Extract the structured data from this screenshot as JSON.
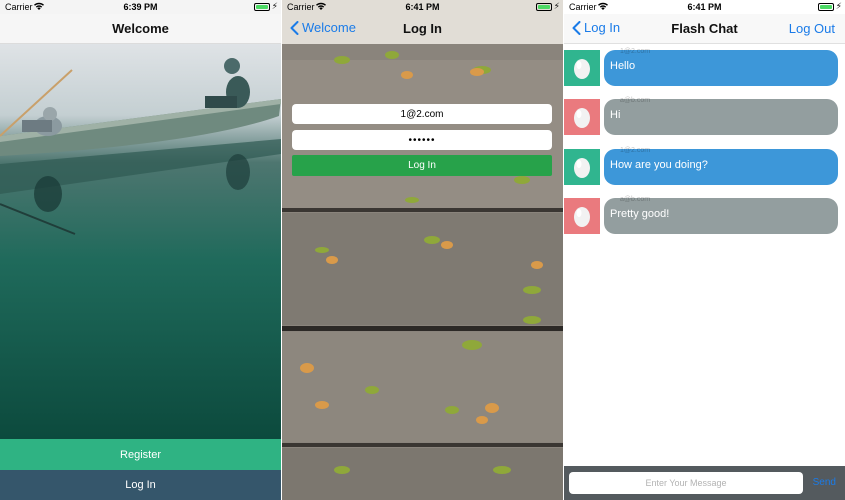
{
  "colors": {
    "register_green": "#2fb383",
    "login_slate": "#35566b",
    "login_green": "#27a24a",
    "ios_blue": "#1a7be8",
    "bubble_blue": "#3d97d9",
    "bubble_grey": "#939e9f",
    "avatar_teal": "#30b58f",
    "avatar_pink": "#ea7a7e",
    "input_bar": "#545a5e"
  },
  "welcome_screen": {
    "status": {
      "carrier": "Carrier",
      "time": "6:39 PM"
    },
    "nav_title": "Welcome",
    "register_label": "Register",
    "login_label": "Log In"
  },
  "login_screen": {
    "status": {
      "carrier": "Carrier",
      "time": "6:41 PM"
    },
    "back_label": "Welcome",
    "nav_title": "Log In",
    "email_value": "1@2.com",
    "password_value": "••••••",
    "login_label": "Log In"
  },
  "chat_screen": {
    "status": {
      "carrier": "Carrier",
      "time": "6:41 PM"
    },
    "back_label": "Log In",
    "nav_title": "Flash Chat",
    "logout_label": "Log Out",
    "messages": [
      {
        "sender": "1@2.com",
        "text": "Hello",
        "side": "self"
      },
      {
        "sender": "a@b.com",
        "text": "Hi",
        "side": "other"
      },
      {
        "sender": "1@2.com",
        "text": "How are you doing?",
        "side": "self"
      },
      {
        "sender": "a@b.com",
        "text": "Pretty good!",
        "side": "other"
      }
    ],
    "input_placeholder": "Enter Your Message",
    "send_label": "Send"
  }
}
